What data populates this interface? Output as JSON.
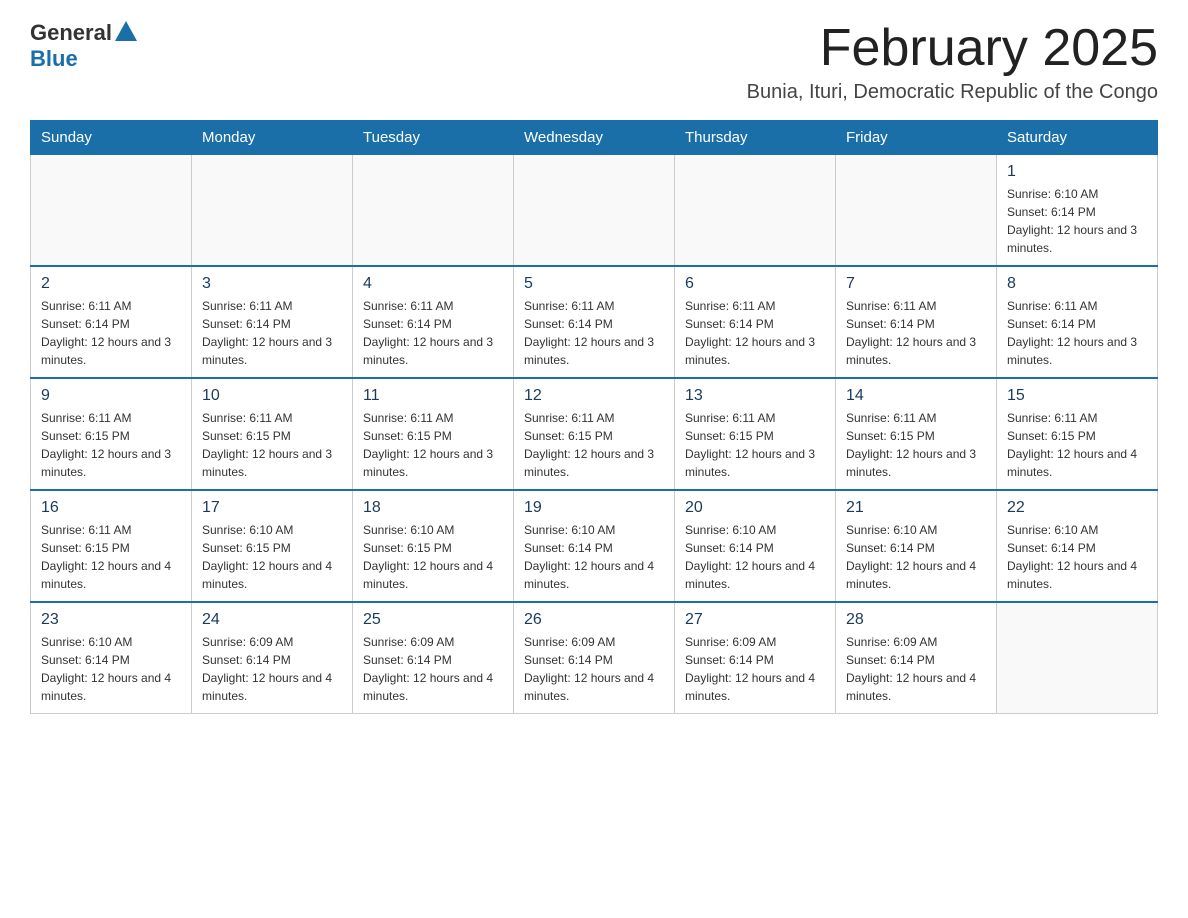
{
  "header": {
    "logo_general": "General",
    "logo_blue": "Blue",
    "title": "February 2025",
    "subtitle": "Bunia, Ituri, Democratic Republic of the Congo"
  },
  "days_of_week": [
    "Sunday",
    "Monday",
    "Tuesday",
    "Wednesday",
    "Thursday",
    "Friday",
    "Saturday"
  ],
  "weeks": [
    [
      {
        "day": "",
        "info": ""
      },
      {
        "day": "",
        "info": ""
      },
      {
        "day": "",
        "info": ""
      },
      {
        "day": "",
        "info": ""
      },
      {
        "day": "",
        "info": ""
      },
      {
        "day": "",
        "info": ""
      },
      {
        "day": "1",
        "info": "Sunrise: 6:10 AM\nSunset: 6:14 PM\nDaylight: 12 hours and 3 minutes."
      }
    ],
    [
      {
        "day": "2",
        "info": "Sunrise: 6:11 AM\nSunset: 6:14 PM\nDaylight: 12 hours and 3 minutes."
      },
      {
        "day": "3",
        "info": "Sunrise: 6:11 AM\nSunset: 6:14 PM\nDaylight: 12 hours and 3 minutes."
      },
      {
        "day": "4",
        "info": "Sunrise: 6:11 AM\nSunset: 6:14 PM\nDaylight: 12 hours and 3 minutes."
      },
      {
        "day": "5",
        "info": "Sunrise: 6:11 AM\nSunset: 6:14 PM\nDaylight: 12 hours and 3 minutes."
      },
      {
        "day": "6",
        "info": "Sunrise: 6:11 AM\nSunset: 6:14 PM\nDaylight: 12 hours and 3 minutes."
      },
      {
        "day": "7",
        "info": "Sunrise: 6:11 AM\nSunset: 6:14 PM\nDaylight: 12 hours and 3 minutes."
      },
      {
        "day": "8",
        "info": "Sunrise: 6:11 AM\nSunset: 6:14 PM\nDaylight: 12 hours and 3 minutes."
      }
    ],
    [
      {
        "day": "9",
        "info": "Sunrise: 6:11 AM\nSunset: 6:15 PM\nDaylight: 12 hours and 3 minutes."
      },
      {
        "day": "10",
        "info": "Sunrise: 6:11 AM\nSunset: 6:15 PM\nDaylight: 12 hours and 3 minutes."
      },
      {
        "day": "11",
        "info": "Sunrise: 6:11 AM\nSunset: 6:15 PM\nDaylight: 12 hours and 3 minutes."
      },
      {
        "day": "12",
        "info": "Sunrise: 6:11 AM\nSunset: 6:15 PM\nDaylight: 12 hours and 3 minutes."
      },
      {
        "day": "13",
        "info": "Sunrise: 6:11 AM\nSunset: 6:15 PM\nDaylight: 12 hours and 3 minutes."
      },
      {
        "day": "14",
        "info": "Sunrise: 6:11 AM\nSunset: 6:15 PM\nDaylight: 12 hours and 3 minutes."
      },
      {
        "day": "15",
        "info": "Sunrise: 6:11 AM\nSunset: 6:15 PM\nDaylight: 12 hours and 4 minutes."
      }
    ],
    [
      {
        "day": "16",
        "info": "Sunrise: 6:11 AM\nSunset: 6:15 PM\nDaylight: 12 hours and 4 minutes."
      },
      {
        "day": "17",
        "info": "Sunrise: 6:10 AM\nSunset: 6:15 PM\nDaylight: 12 hours and 4 minutes."
      },
      {
        "day": "18",
        "info": "Sunrise: 6:10 AM\nSunset: 6:15 PM\nDaylight: 12 hours and 4 minutes."
      },
      {
        "day": "19",
        "info": "Sunrise: 6:10 AM\nSunset: 6:14 PM\nDaylight: 12 hours and 4 minutes."
      },
      {
        "day": "20",
        "info": "Sunrise: 6:10 AM\nSunset: 6:14 PM\nDaylight: 12 hours and 4 minutes."
      },
      {
        "day": "21",
        "info": "Sunrise: 6:10 AM\nSunset: 6:14 PM\nDaylight: 12 hours and 4 minutes."
      },
      {
        "day": "22",
        "info": "Sunrise: 6:10 AM\nSunset: 6:14 PM\nDaylight: 12 hours and 4 minutes."
      }
    ],
    [
      {
        "day": "23",
        "info": "Sunrise: 6:10 AM\nSunset: 6:14 PM\nDaylight: 12 hours and 4 minutes."
      },
      {
        "day": "24",
        "info": "Sunrise: 6:09 AM\nSunset: 6:14 PM\nDaylight: 12 hours and 4 minutes."
      },
      {
        "day": "25",
        "info": "Sunrise: 6:09 AM\nSunset: 6:14 PM\nDaylight: 12 hours and 4 minutes."
      },
      {
        "day": "26",
        "info": "Sunrise: 6:09 AM\nSunset: 6:14 PM\nDaylight: 12 hours and 4 minutes."
      },
      {
        "day": "27",
        "info": "Sunrise: 6:09 AM\nSunset: 6:14 PM\nDaylight: 12 hours and 4 minutes."
      },
      {
        "day": "28",
        "info": "Sunrise: 6:09 AM\nSunset: 6:14 PM\nDaylight: 12 hours and 4 minutes."
      },
      {
        "day": "",
        "info": ""
      }
    ]
  ],
  "accent_color": "#1a6fa8"
}
